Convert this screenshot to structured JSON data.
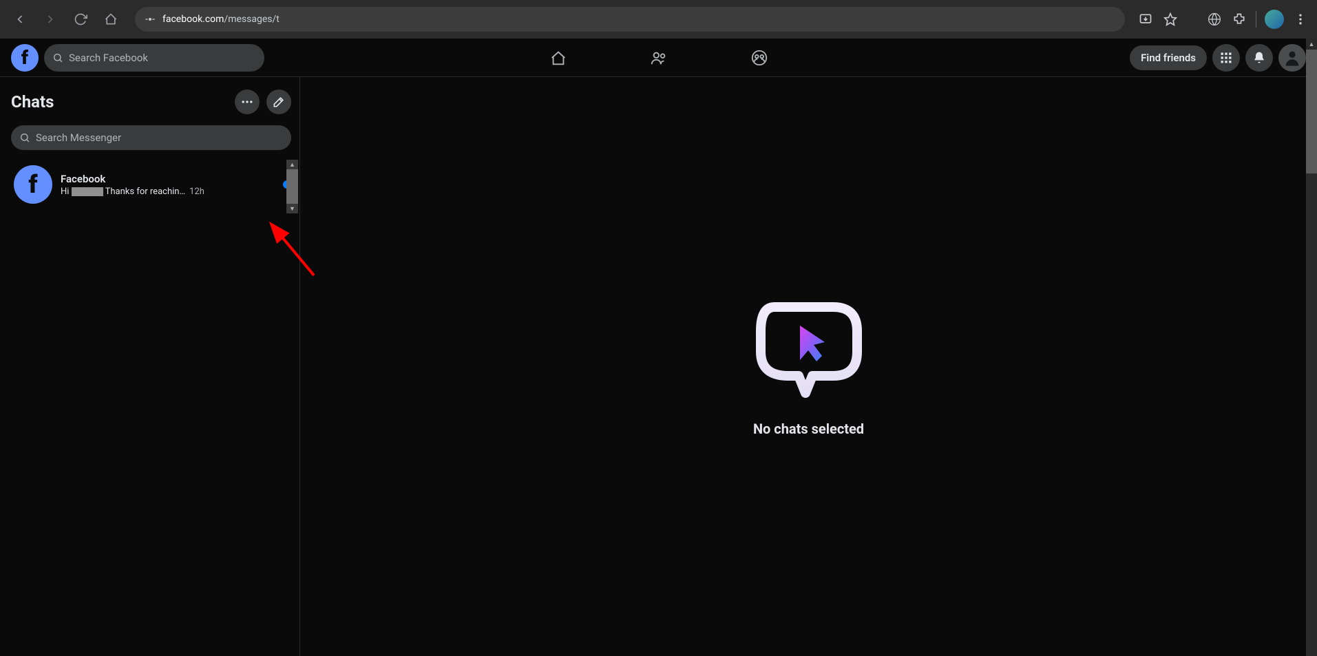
{
  "browser": {
    "url_domain": "facebook.com",
    "url_path": "/messages/t"
  },
  "header": {
    "search_placeholder": "Search Facebook",
    "find_friends": "Find friends"
  },
  "sidebar": {
    "title": "Chats",
    "search_placeholder": "Search Messenger",
    "chats": [
      {
        "name": "Facebook",
        "preview_prefix": "Hi ",
        "preview_suffix": " Thanks for reachin…",
        "time": "12h",
        "unread": true
      }
    ]
  },
  "conversation": {
    "empty_text": "No chats selected"
  }
}
